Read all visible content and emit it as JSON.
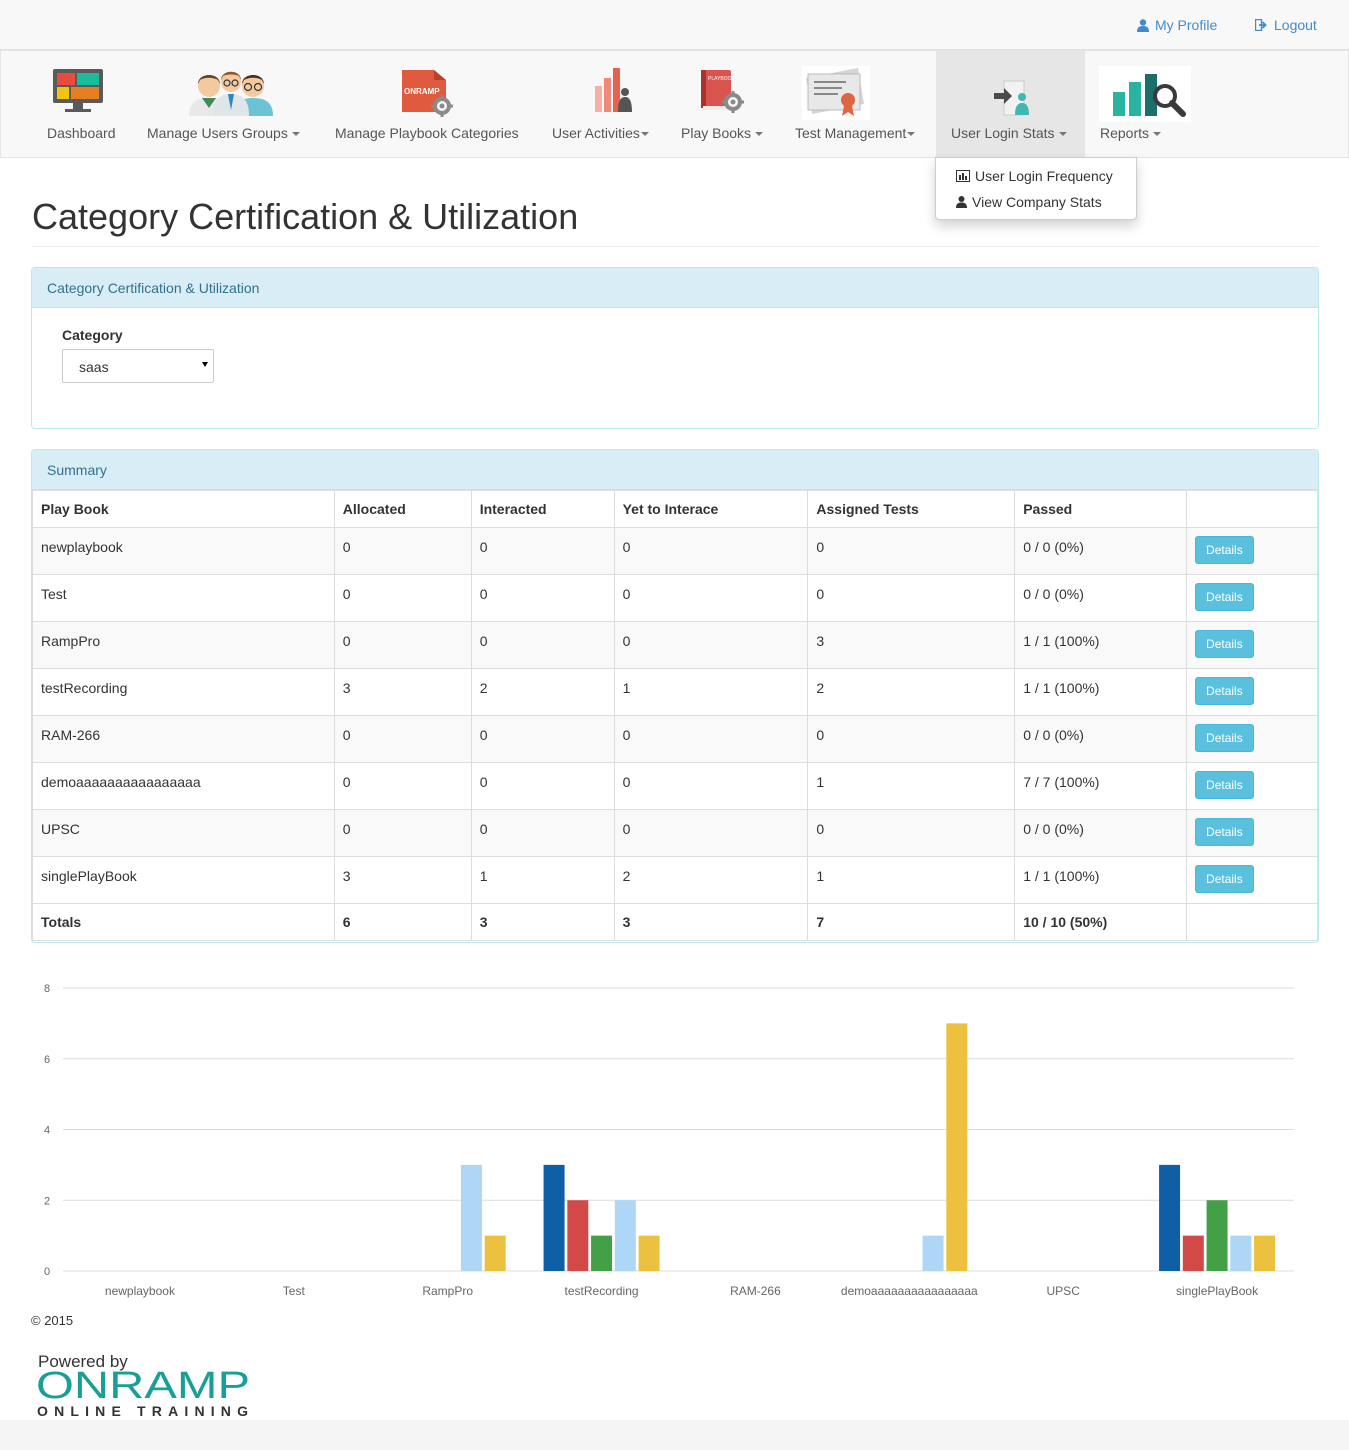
{
  "header": {
    "my_profile": "My Profile",
    "logout": "Logout"
  },
  "nav": {
    "items": [
      {
        "label": "Dashboard",
        "icon": "dashboard-monitor-icon"
      },
      {
        "label": "Manage Users Groups",
        "icon": "users-group-icon"
      },
      {
        "label": "Manage Playbook Categories",
        "icon": "onramp-playbook-gear-icon",
        "icon_text": "ONRAMP"
      },
      {
        "label": "User Activities",
        "icon": "activity-bars-icon"
      },
      {
        "label": "Play Books",
        "icon": "playbook-book-gear-icon",
        "icon_text": "PLAYBOOK"
      },
      {
        "label": "Test Management",
        "icon": "certificate-icon"
      },
      {
        "label": "User Login Stats",
        "icon": "user-login-icon"
      },
      {
        "label": "Reports",
        "icon": "reports-chart-search-icon"
      }
    ],
    "dropdown": [
      {
        "label": "User Login Frequency",
        "icon": "bar-chart-icon"
      },
      {
        "label": "View Company Stats",
        "icon": "user-icon"
      }
    ]
  },
  "page": {
    "title": "Category Certification & Utilization"
  },
  "filter_panel": {
    "heading": "Category Certification & Utilization",
    "category_label": "Category",
    "category_value": "saas"
  },
  "summary": {
    "heading": "Summary",
    "columns": [
      "Play Book",
      "Allocated",
      "Interacted",
      "Yet to Interace",
      "Assigned Tests",
      "Passed",
      ""
    ],
    "rows": [
      {
        "playbook": "newplaybook",
        "allocated": "0",
        "interacted": "0",
        "yet": "0",
        "assigned": "0",
        "passed": "0 / 0 (0%)"
      },
      {
        "playbook": "Test",
        "allocated": "0",
        "interacted": "0",
        "yet": "0",
        "assigned": "0",
        "passed": "0 / 0 (0%)"
      },
      {
        "playbook": "RampPro",
        "allocated": "0",
        "interacted": "0",
        "yet": "0",
        "assigned": "3",
        "passed": "1 / 1 (100%)"
      },
      {
        "playbook": "testRecording",
        "allocated": "3",
        "interacted": "2",
        "yet": "1",
        "assigned": "2",
        "passed": "1 / 1 (100%)"
      },
      {
        "playbook": "RAM-266",
        "allocated": "0",
        "interacted": "0",
        "yet": "0",
        "assigned": "0",
        "passed": "0 / 0 (0%)"
      },
      {
        "playbook": "demoaaaaaaaaaaaaaaaa",
        "allocated": "0",
        "interacted": "0",
        "yet": "0",
        "assigned": "1",
        "passed": "7 / 7 (100%)"
      },
      {
        "playbook": "UPSC",
        "allocated": "0",
        "interacted": "0",
        "yet": "0",
        "assigned": "0",
        "passed": "0 / 0 (0%)"
      },
      {
        "playbook": "singlePlayBook",
        "allocated": "3",
        "interacted": "1",
        "yet": "2",
        "assigned": "1",
        "passed": "1 / 1 (100%)"
      }
    ],
    "details_label": "Details",
    "totals": {
      "label": "Totals",
      "allocated": "6",
      "interacted": "3",
      "yet": "3",
      "assigned": "7",
      "passed": "10 / 10 (50%)"
    }
  },
  "chart_data": {
    "type": "bar",
    "categories": [
      "newplaybook",
      "Test",
      "RampPro",
      "testRecording",
      "RAM-266",
      "demoaaaaaaaaaaaaaaaa",
      "UPSC",
      "singlePlayBook"
    ],
    "series": [
      {
        "values": [
          0,
          0,
          0,
          3,
          0,
          0,
          0,
          3
        ],
        "color": "#0f5fa6"
      },
      {
        "values": [
          0,
          0,
          0,
          2,
          0,
          0,
          0,
          1
        ],
        "color": "#d24a48"
      },
      {
        "values": [
          0,
          0,
          0,
          1,
          0,
          0,
          0,
          2
        ],
        "color": "#43a047"
      },
      {
        "values": [
          0,
          0,
          3,
          2,
          0,
          1,
          0,
          1
        ],
        "color": "#aed6f6"
      },
      {
        "values": [
          0,
          0,
          1,
          1,
          0,
          7,
          0,
          1
        ],
        "color": "#ecc13f"
      }
    ],
    "ylim": [
      0,
      8
    ],
    "yticks": [
      "0",
      "2",
      "4",
      "6",
      "8"
    ],
    "grid": true
  },
  "footer": {
    "copyright": "© 2015",
    "powered_by": "Powered by",
    "brand": "ONRAMP",
    "tagline": "ONLINE TRAINING"
  },
  "colors": {
    "link": "#428bca",
    "panel_heading_bg": "#d9edf7",
    "panel_heading_text": "#31708f",
    "details_button": "#5bc0de",
    "brand_teal": "#1a9f96"
  }
}
